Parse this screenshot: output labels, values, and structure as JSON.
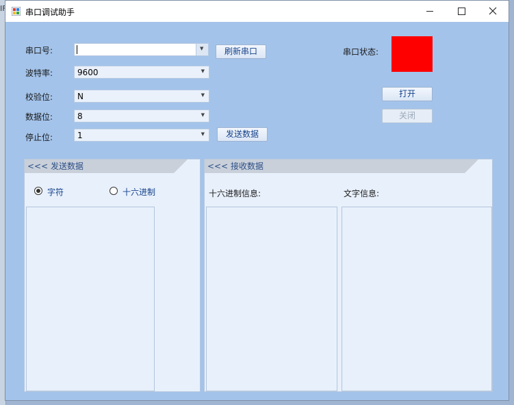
{
  "background": {
    "edge_text": "IF"
  },
  "window": {
    "title": "串口调试助手",
    "minimize_icon": "minimize-icon",
    "maximize_icon": "maximize-icon",
    "close_icon": "close-icon"
  },
  "form": {
    "port_label": "串口号:",
    "port_value": "",
    "baud_label": "波特率:",
    "baud_value": "9600",
    "parity_label": "校验位:",
    "parity_value": "N",
    "databits_label": "数据位:",
    "databits_value": "8",
    "stopbits_label": "停止位:",
    "stopbits_value": "1",
    "refresh_button": "刷新串口",
    "send_button": "发送数据",
    "status_label": "串口状态:",
    "status_color": "#ff0000",
    "open_button": "打开",
    "close_button": "关闭"
  },
  "send_panel": {
    "header": "<<< 发送数据",
    "radio_char": "字符",
    "radio_hex": "十六进制",
    "selected": "字符"
  },
  "receive_panel": {
    "header": "<<< 接收数据",
    "hex_label": "十六进制信息:",
    "text_label": "文字信息:"
  }
}
